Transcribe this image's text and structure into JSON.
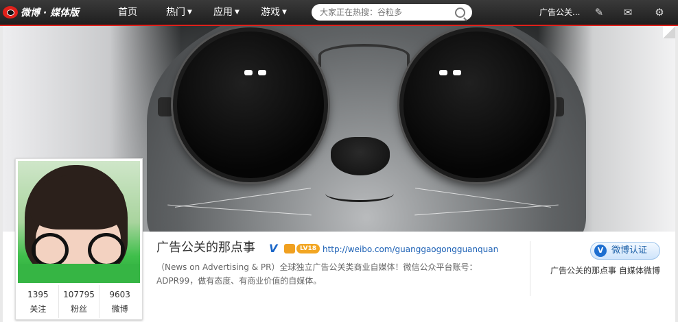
{
  "topbar": {
    "brand": "微博 · 媒体版",
    "nav": [
      {
        "label": "首页",
        "has_caret": false
      },
      {
        "label": "热门",
        "has_caret": true
      },
      {
        "label": "应用",
        "has_caret": true
      },
      {
        "label": "游戏",
        "has_caret": true
      }
    ],
    "search": {
      "placeholder": "大家正在热搜：谷粒多"
    },
    "user_name": "广告公关...",
    "icons": [
      "edit-icon",
      "mail-icon",
      "gear-icon"
    ]
  },
  "profile": {
    "name": "广告公关的那点事",
    "verified_badge": "V",
    "level": "LV18",
    "url": "http://weibo.com/guanggaogongguanquan",
    "bio": "（News on Advertising & PR）全球独立广告公关类商业自媒体！微信公众平台账号：ADPR99，做有态度、有商业价值的自媒体。",
    "stats": [
      {
        "num": "1395",
        "label": "关注"
      },
      {
        "num": "107795",
        "label": "粉丝"
      },
      {
        "num": "9603",
        "label": "微博"
      }
    ],
    "verify_button": "微博认证",
    "verify_icon": "V",
    "verify_desc": "广告公关的那点事 自媒体微博"
  },
  "colors": {
    "accent": "#e0201a",
    "link": "#1a5fb4",
    "verified": "#1e6fd0"
  }
}
